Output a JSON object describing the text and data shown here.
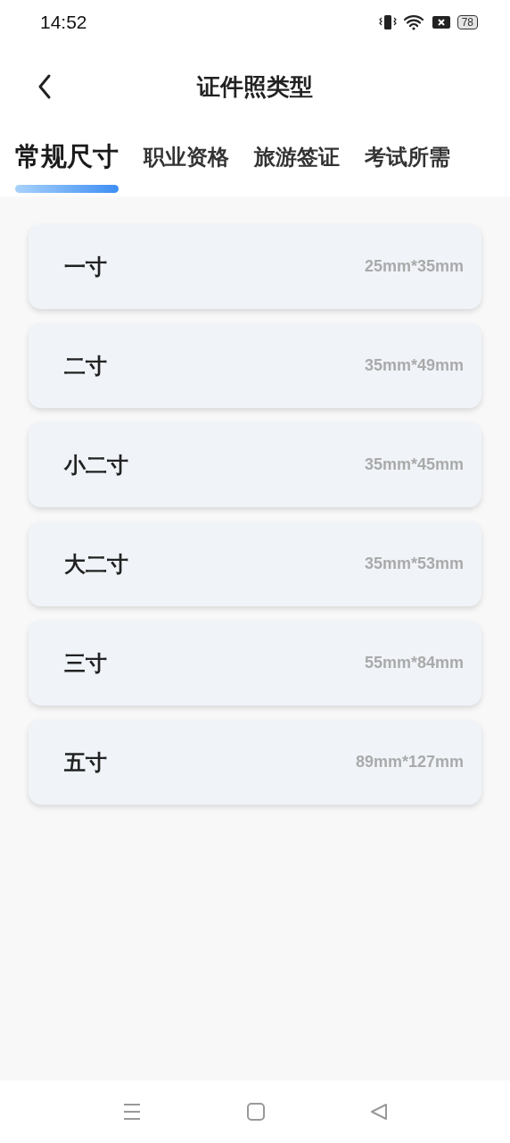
{
  "status_bar": {
    "time": "14:52",
    "battery": "78"
  },
  "header": {
    "title": "证件照类型"
  },
  "tabs": [
    {
      "label": "常规尺寸",
      "selected": true
    },
    {
      "label": "职业资格",
      "selected": false
    },
    {
      "label": "旅游签证",
      "selected": false
    },
    {
      "label": "考试所需",
      "selected": false
    }
  ],
  "sizes": [
    {
      "name": "一寸",
      "dimensions": "25mm*35mm"
    },
    {
      "name": "二寸",
      "dimensions": "35mm*49mm"
    },
    {
      "name": "小二寸",
      "dimensions": "35mm*45mm"
    },
    {
      "name": "大二寸",
      "dimensions": "35mm*53mm"
    },
    {
      "name": "三寸",
      "dimensions": "55mm*84mm"
    },
    {
      "name": "五寸",
      "dimensions": "89mm*127mm"
    }
  ]
}
